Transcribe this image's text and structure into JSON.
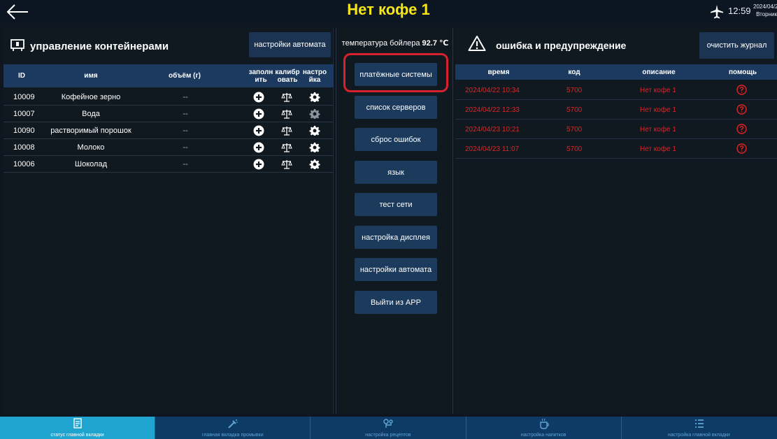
{
  "topbar": {
    "title": "Нет кофе 1",
    "time": "12:59",
    "date": "2024/04/2",
    "weekday": "Вторник"
  },
  "containers": {
    "title": "управление контейнерами",
    "settings_button": "настройки автомата",
    "columns": [
      "ID",
      "имя",
      "объём (г)",
      "заполн ить",
      "калибр овать",
      "настро йка"
    ],
    "rows": [
      {
        "id": "10009",
        "name": "Кофейное зерно",
        "volume": "--",
        "settings_disabled": false
      },
      {
        "id": "10007",
        "name": "Вода",
        "volume": "--",
        "settings_disabled": true
      },
      {
        "id": "10090",
        "name": "растворимый порошок",
        "volume": "--",
        "settings_disabled": false
      },
      {
        "id": "10008",
        "name": "Молоко",
        "volume": "--",
        "settings_disabled": false
      },
      {
        "id": "10006",
        "name": "Шоколад",
        "volume": "--",
        "settings_disabled": false
      }
    ]
  },
  "middle": {
    "temperature_label": "температура бойлера",
    "temperature_value": "92.7 ℃",
    "buttons": [
      "платёжные системы",
      "список серверов",
      "сброс ошибок",
      "язык",
      "тест сети",
      "настройка дисплея",
      "настройки автомата",
      "Выйти из APP"
    ]
  },
  "errors": {
    "title": "ошибка и предупреждение",
    "clear_button": "очистить журнал",
    "columns": [
      "время",
      "код",
      "описание",
      "помощь"
    ],
    "rows": [
      {
        "time": "2024/04/22 10:34",
        "code": "5700",
        "description": "Нет кофе 1"
      },
      {
        "time": "2024/04/22 12:33",
        "code": "5700",
        "description": "Нет кофе 1"
      },
      {
        "time": "2024/04/23 10:21",
        "code": "5700",
        "description": "Нет кофе 1"
      },
      {
        "time": "2024/04/23 11:07",
        "code": "5700",
        "description": "Нет кофе 1"
      }
    ]
  },
  "tabs": [
    {
      "label": "статус главной вкладки",
      "active": true,
      "icon": "status-icon"
    },
    {
      "label": "главная вкладка промывки",
      "active": false,
      "icon": "wash-icon"
    },
    {
      "label": "настройка рецептов",
      "active": false,
      "icon": "recipe-icon"
    },
    {
      "label": "настройка напитков",
      "active": false,
      "icon": "drink-icon"
    },
    {
      "label": "настройка главной вкладки",
      "active": false,
      "icon": "list-icon"
    }
  ],
  "colors": {
    "title": "#f5e61a",
    "error_text": "#e02525",
    "accent_tab": "#1fa3cf",
    "highlight": "#d8222b"
  }
}
